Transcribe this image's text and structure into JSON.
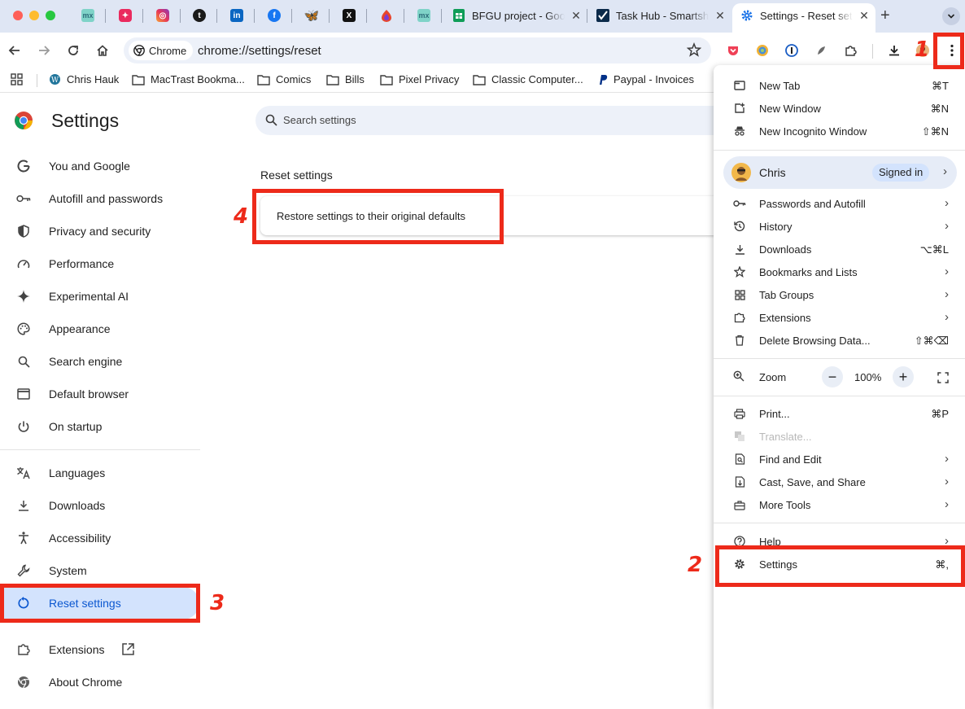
{
  "tabs": [
    {
      "title": "BFGU project - Goo",
      "active": false
    },
    {
      "title": "Task Hub - Smartsheet",
      "active": false
    },
    {
      "title": "Settings - Reset settings",
      "active": true
    }
  ],
  "pinned_tab_icons": [
    "mx-icon",
    "app-icon",
    "instagram-icon",
    "tumblr-icon",
    "linkedin-icon",
    "facebook-icon",
    "bluesky-icon",
    "x-icon",
    "app-icon",
    "mx-icon"
  ],
  "toolbar": {
    "chip_label": "Chrome",
    "url": "chrome://settings/reset"
  },
  "bookmarks": [
    {
      "label": "Chris Hauk",
      "icon": "wordpress-icon"
    },
    {
      "label": "MacTrast Bookma...",
      "icon": "folder-icon"
    },
    {
      "label": "Comics",
      "icon": "folder-icon"
    },
    {
      "label": "Bills",
      "icon": "folder-icon"
    },
    {
      "label": "Pixel Privacy",
      "icon": "folder-icon"
    },
    {
      "label": "Classic Computer...",
      "icon": "folder-icon"
    },
    {
      "label": "Paypal - Invoices",
      "icon": "paypal-icon"
    }
  ],
  "settings": {
    "title": "Settings",
    "search_placeholder": "Search settings",
    "nav": [
      {
        "label": "You and Google",
        "icon": "google-icon"
      },
      {
        "label": "Autofill and passwords",
        "icon": "key-icon"
      },
      {
        "label": "Privacy and security",
        "icon": "shield-icon"
      },
      {
        "label": "Performance",
        "icon": "speedometer-icon"
      },
      {
        "label": "Experimental AI",
        "icon": "sparkle-icon"
      },
      {
        "label": "Appearance",
        "icon": "palette-icon"
      },
      {
        "label": "Search engine",
        "icon": "search-icon"
      },
      {
        "label": "Default browser",
        "icon": "browser-icon"
      },
      {
        "label": "On startup",
        "icon": "power-icon"
      },
      {
        "label": "Languages",
        "icon": "translate-icon"
      },
      {
        "label": "Downloads",
        "icon": "download-icon"
      },
      {
        "label": "Accessibility",
        "icon": "accessibility-icon"
      },
      {
        "label": "System",
        "icon": "wrench-icon"
      },
      {
        "label": "Reset settings",
        "icon": "reset-icon",
        "active": true
      },
      {
        "label": "Extensions",
        "icon": "extension-icon"
      },
      {
        "label": "About Chrome",
        "icon": "chrome-icon"
      }
    ],
    "section_title": "Reset settings",
    "restore_label": "Restore settings to their original defaults"
  },
  "menu": {
    "new_tab": {
      "label": "New Tab",
      "shortcut": "⌘T"
    },
    "new_window": {
      "label": "New Window",
      "shortcut": "⌘N"
    },
    "new_incognito": {
      "label": "New Incognito Window",
      "shortcut": "⇧⌘N"
    },
    "profile": {
      "name": "Chris",
      "badge": "Signed in"
    },
    "passwords": {
      "label": "Passwords and Autofill"
    },
    "history": {
      "label": "History"
    },
    "downloads": {
      "label": "Downloads",
      "shortcut": "⌥⌘L"
    },
    "bookmarks": {
      "label": "Bookmarks and Lists"
    },
    "tab_groups": {
      "label": "Tab Groups"
    },
    "extensions": {
      "label": "Extensions"
    },
    "delete_data": {
      "label": "Delete Browsing Data...",
      "shortcut": "⇧⌘⌫"
    },
    "zoom": {
      "label": "Zoom",
      "minus": "−",
      "value": "100%",
      "plus": "+"
    },
    "print": {
      "label": "Print...",
      "shortcut": "⌘P"
    },
    "translate": {
      "label": "Translate..."
    },
    "find_edit": {
      "label": "Find and Edit"
    },
    "cast_save": {
      "label": "Cast, Save, and Share"
    },
    "more_tools": {
      "label": "More Tools"
    },
    "help": {
      "label": "Help"
    },
    "settings": {
      "label": "Settings",
      "shortcut": "⌘,"
    }
  },
  "annotations": {
    "step1": "1",
    "step2": "2",
    "step3": "3",
    "step4": "4",
    "color": "#ed2a1a"
  }
}
